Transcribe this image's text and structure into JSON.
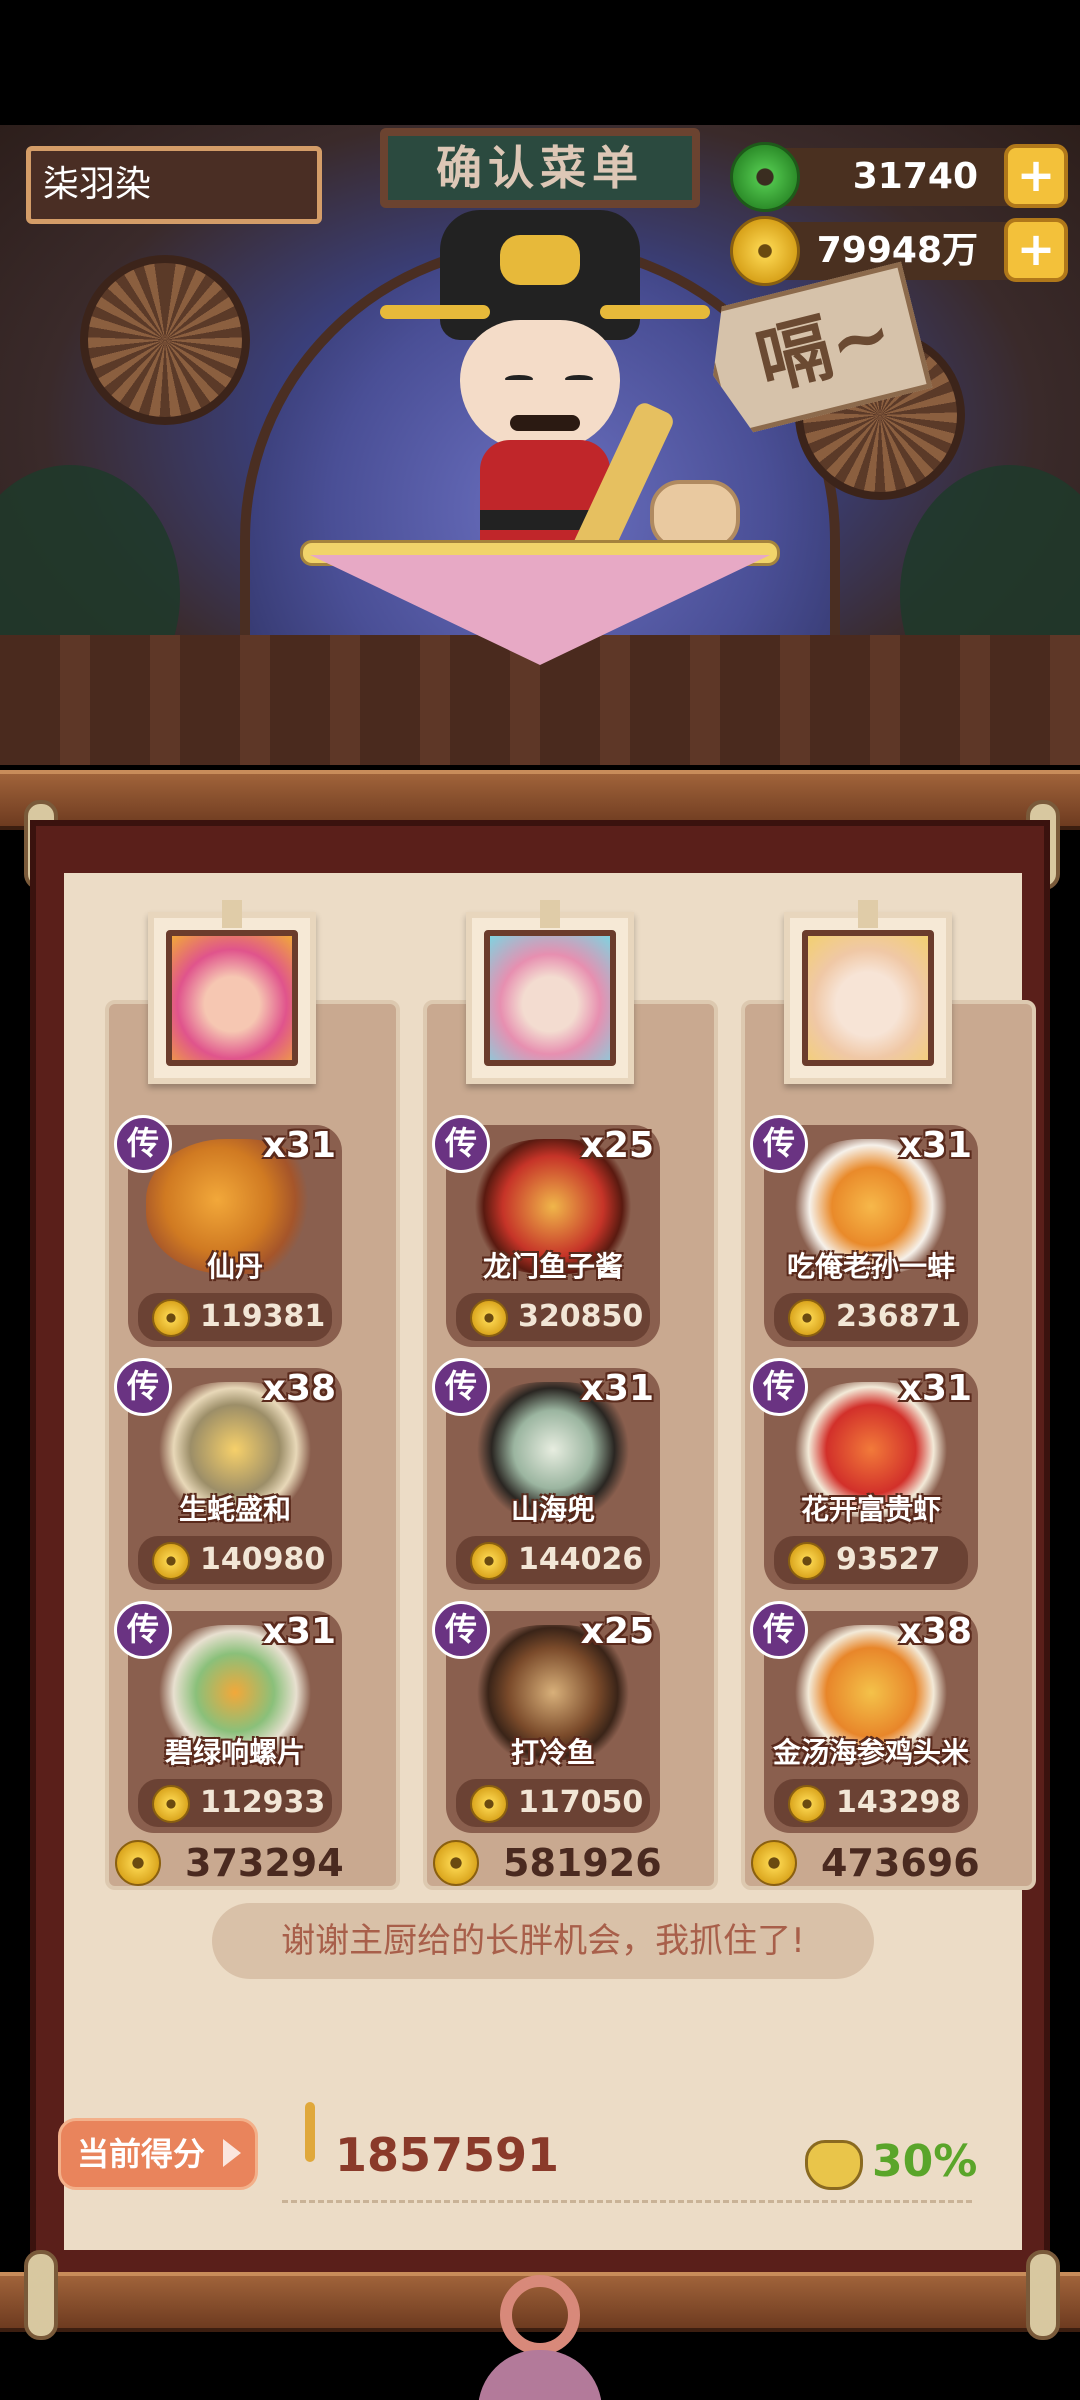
{
  "header": {
    "title": "确认菜单",
    "player_name": "柒羽染",
    "currencies": {
      "jade": "31740",
      "gold": "79948万"
    },
    "plus_label": "+",
    "speech_tag": "嗝~"
  },
  "columns": [
    {
      "total": "373294",
      "dishes": [
        {
          "badge": "传",
          "count": "x31",
          "name": "仙丹",
          "price": "119381"
        },
        {
          "badge": "传",
          "count": "x38",
          "name": "生蚝盛和",
          "price": "140980"
        },
        {
          "badge": "传",
          "count": "x31",
          "name": "碧绿响螺片",
          "price": "112933"
        }
      ]
    },
    {
      "total": "581926",
      "dishes": [
        {
          "badge": "传",
          "count": "x25",
          "name": "龙门鱼子酱",
          "price": "320850"
        },
        {
          "badge": "传",
          "count": "x31",
          "name": "山海兜",
          "price": "144026"
        },
        {
          "badge": "传",
          "count": "x25",
          "name": "打冷鱼",
          "price": "117050"
        }
      ]
    },
    {
      "total": "473696",
      "dishes": [
        {
          "badge": "传",
          "count": "x31",
          "name": "吃俺老孙一蚌",
          "price": "236871"
        },
        {
          "badge": "传",
          "count": "x31",
          "name": "花开富贵虾",
          "price": "93527"
        },
        {
          "badge": "传",
          "count": "x38",
          "name": "金汤海参鸡头米",
          "price": "143298"
        }
      ]
    }
  ],
  "quote": "谢谢主厨给的长胖机会，我抓住了!",
  "score": {
    "label": "当前得分",
    "value": "1857591",
    "percent": "30%"
  },
  "colors": {
    "badge_purple": "#6a3382",
    "score_button": "#e9845c",
    "percent_green": "#5aa52a"
  }
}
